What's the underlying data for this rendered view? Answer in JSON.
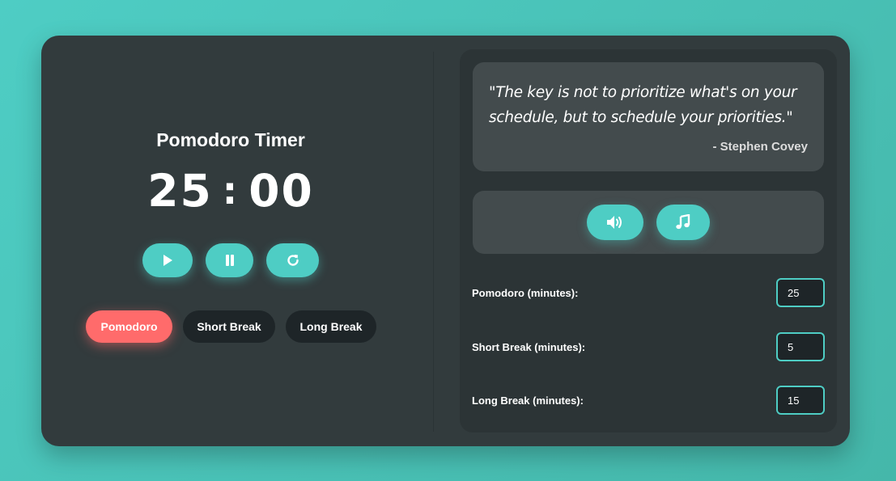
{
  "timer": {
    "title": "Pomodoro Timer",
    "minutes": "25",
    "separator": ":",
    "seconds": "00"
  },
  "controls": {
    "play_icon": "play-icon",
    "pause_icon": "pause-icon",
    "reset_icon": "reset-icon"
  },
  "modes": [
    {
      "label": "Pomodoro",
      "active": true
    },
    {
      "label": "Short Break",
      "active": false
    },
    {
      "label": "Long Break",
      "active": false
    }
  ],
  "quote": {
    "text": "\"The key is not to prioritize what's on your schedule, but to schedule your priorities.\"",
    "author": "- Stephen Covey"
  },
  "sounds": {
    "volume_icon": "volume-icon",
    "music_icon": "music-icon"
  },
  "settings": {
    "pomodoro": {
      "label": "Pomodoro (minutes):",
      "value": "25"
    },
    "short_break": {
      "label": "Short Break (minutes):",
      "value": "5"
    },
    "long_break": {
      "label": "Long Break (minutes):",
      "value": "15"
    }
  },
  "colors": {
    "accent": "#4ecdc4",
    "active_mode": "#ff6b6b",
    "card": "#323b3d",
    "panel": "#434b4d"
  }
}
